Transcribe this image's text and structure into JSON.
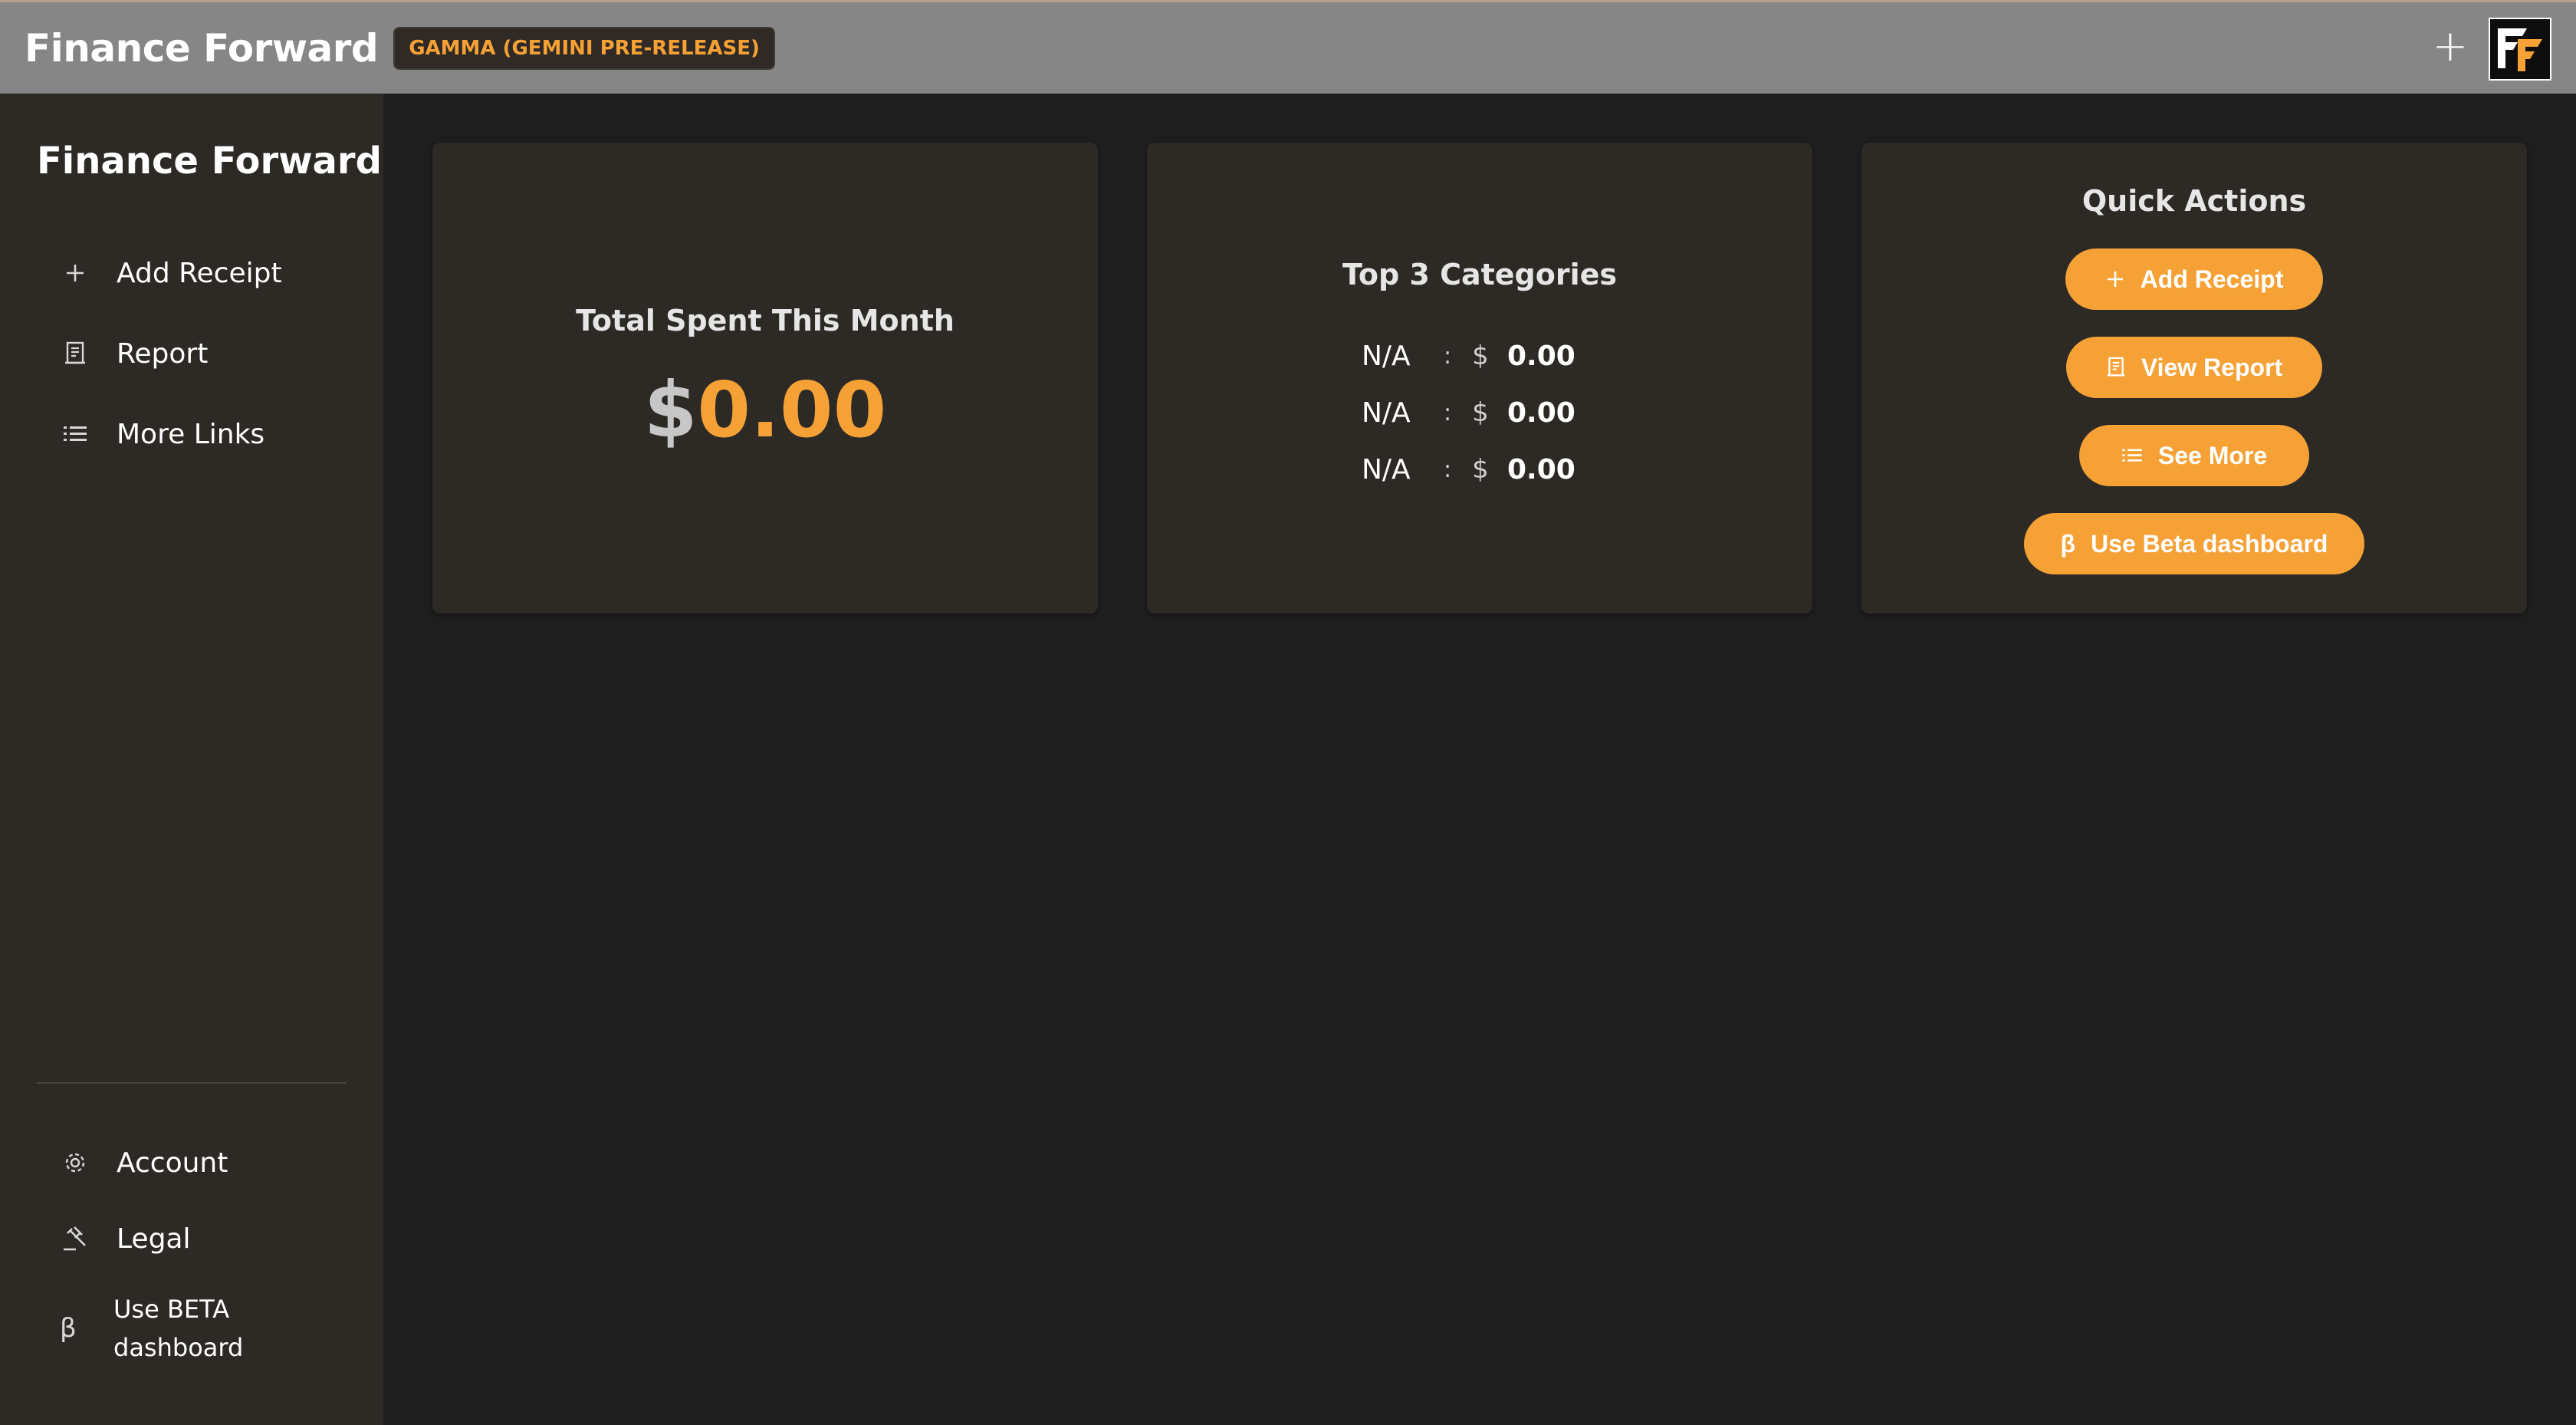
{
  "header": {
    "app_title": "Finance Forward",
    "env_badge": "GAMMA (GEMINI PRE-RELEASE)",
    "add_icon": "plus-icon",
    "logo_icon": "finance-forward-logo"
  },
  "sidebar": {
    "title": "Finance Forward",
    "items": [
      {
        "label": "Add Receipt",
        "icon": "plus-icon"
      },
      {
        "label": "Report",
        "icon": "receipt-icon"
      },
      {
        "label": "More Links",
        "icon": "list-icon"
      }
    ],
    "bottom_items": [
      {
        "label": "Account",
        "icon": "gear-icon"
      },
      {
        "label": "Legal",
        "icon": "gavel-icon"
      },
      {
        "label": "Use BETA dashboard",
        "icon": "beta-icon"
      }
    ]
  },
  "cards": {
    "total": {
      "title": "Total Spent This Month",
      "currency": "$",
      "amount": "0.00"
    },
    "categories": {
      "title": "Top 3 Categories",
      "rows": [
        {
          "name": "N/A",
          "sep": ":",
          "currency": "$",
          "amount": "0.00"
        },
        {
          "name": "N/A",
          "sep": ":",
          "currency": "$",
          "amount": "0.00"
        },
        {
          "name": "N/A",
          "sep": ":",
          "currency": "$",
          "amount": "0.00"
        }
      ]
    },
    "quick_actions": {
      "title": "Quick Actions",
      "buttons": [
        {
          "label": "Add Receipt",
          "icon": "plus-icon"
        },
        {
          "label": "View Report",
          "icon": "receipt-icon"
        },
        {
          "label": "See More",
          "icon": "list-icon"
        },
        {
          "label": "Use Beta dashboard",
          "icon": "beta-icon"
        }
      ]
    }
  },
  "colors": {
    "accent": "#f5a136",
    "topbar": "#868686",
    "sidebar": "#2d2a26",
    "background": "#1e1e1e",
    "card": "#2d2a26"
  }
}
